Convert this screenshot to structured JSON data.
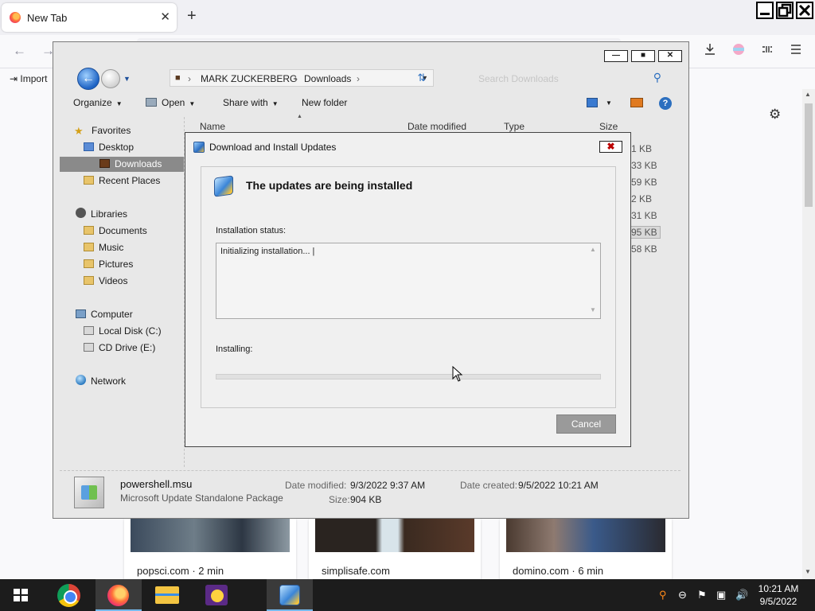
{
  "firefox": {
    "tab_title": "New Tab",
    "tab_close": "✕",
    "new_tab": "+",
    "bookmarks_import": "Import",
    "icons": [
      "back-arrow-icon",
      "forward-arrow-icon",
      "download-icon",
      "account-icon",
      "extensions-icon",
      "menu-icon",
      "gear-icon"
    ]
  },
  "cards": [
    {
      "source": "popsci.com · 2 min"
    },
    {
      "source": "simplisafe.com"
    },
    {
      "source": "domino.com · 6 min"
    }
  ],
  "explorer": {
    "breadcrumb": [
      "MARK ZUCKERBERG",
      "Downloads"
    ],
    "search_placeholder": "Search Downloads",
    "toolbar": {
      "organize": "Organize",
      "open": "Open",
      "share_with": "Share with",
      "new_folder": "New folder"
    },
    "nav": {
      "favorites": "Favorites",
      "desktop": "Desktop",
      "downloads": "Downloads",
      "recent_places": "Recent Places",
      "libraries": "Libraries",
      "documents": "Documents",
      "music": "Music",
      "pictures": "Pictures",
      "videos": "Videos",
      "computer": "Computer",
      "local_disk": "Local Disk (C:)",
      "cd_drive": "CD Drive (E:)",
      "network": "Network"
    },
    "columns": {
      "name": "Name",
      "date_modified": "Date modified",
      "type": "Type",
      "size": "Size"
    },
    "size_cells": [
      "1 KB",
      "33 KB",
      "59 KB",
      "2 KB",
      "31 KB",
      "95 KB",
      "58 KB"
    ],
    "details": {
      "file_name": "powershell.msu",
      "file_type": "Microsoft Update Standalone Package",
      "date_modified_label": "Date modified:",
      "date_modified_value": "9/3/2022 9:37 AM",
      "date_created_label": "Date created:",
      "date_created_value": "9/5/2022 10:21 AM",
      "size_label": "Size:",
      "size_value": "904 KB"
    }
  },
  "dialog": {
    "title": "Download and Install Updates",
    "heading": "The updates are being installed",
    "status_label": "Installation status:",
    "status_text": "Initializing installation... |",
    "installing_label": "Installing:",
    "progress": 0.0,
    "cancel": "Cancel"
  },
  "taskbar": {
    "apps": [
      "windows-start",
      "chrome",
      "firefox",
      "file-explorer",
      "yahoo-messenger",
      "windows-update"
    ],
    "time": "10:21 AM",
    "date": "9/5/2022"
  },
  "colors": {
    "taskbar_bg": "#1c1c1c",
    "dialog_bg": "#f0f0f0",
    "selected_nav": "#8a8a8a",
    "accent_blue": "#2c6fbf"
  }
}
